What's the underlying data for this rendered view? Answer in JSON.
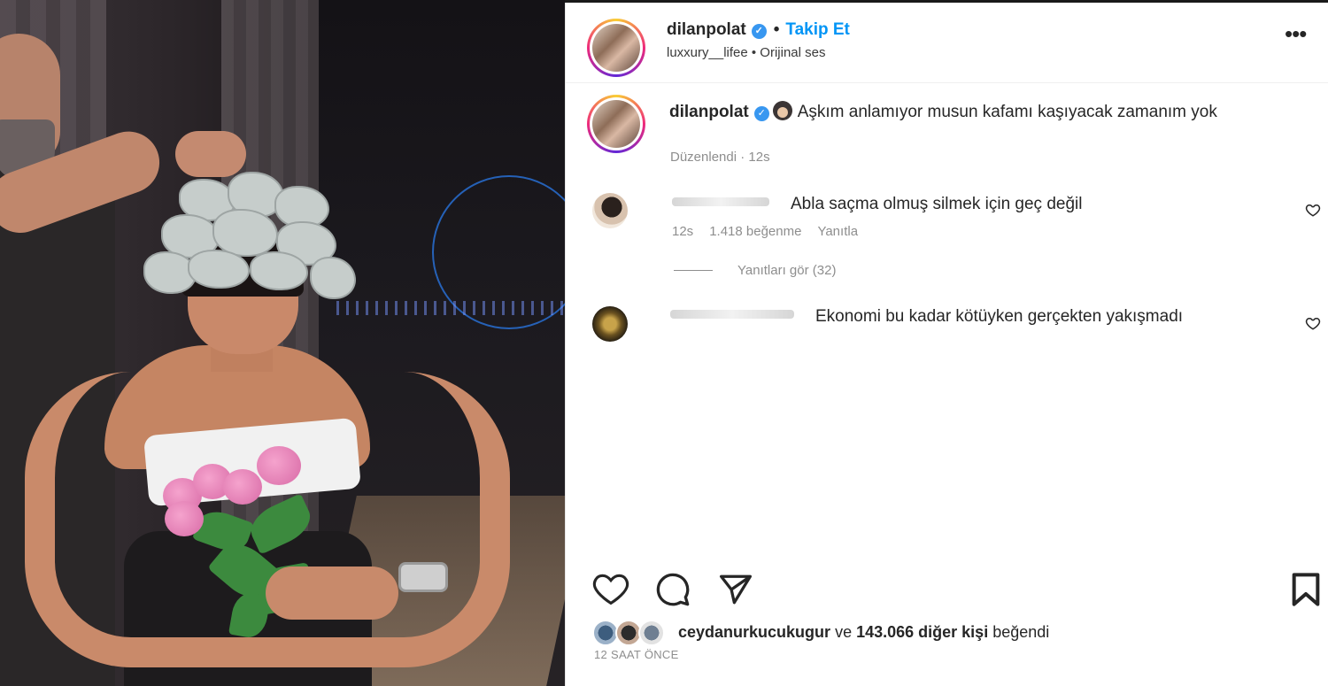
{
  "post": {
    "username": "dilanpolat",
    "follow_label": "Takip Et",
    "audio_subtitle": "luxxury__lifee • Orijinal ses",
    "more_label": "•••"
  },
  "caption": {
    "username": "dilanpolat",
    "text": "Aşkım anlamıyor musun kafamı kaşıyacak zamanım yok",
    "meta": "Düzenlendi · 12s"
  },
  "comments": [
    {
      "text": "Abla saçma olmuş silmek için geç değil",
      "time": "12s",
      "likes": "1.418 beğenme",
      "reply_label": "Yanıtla",
      "view_replies": "Yanıtları gör (32)"
    },
    {
      "text": "Ekonomi bu kadar kötüyken gerçekten yakışmadı"
    }
  ],
  "likes": {
    "liker": "ceydanurkucukugur",
    "connector": "ve",
    "others": "143.066 diğer kişi",
    "suffix": "beğendi"
  },
  "timestamp": "12 SAAT ÖNCE",
  "icons": [
    "verified-badge-icon",
    "heart-icon",
    "comment-icon",
    "share-icon",
    "bookmark-icon",
    "more-options-icon"
  ],
  "colors": {
    "accent": "#0095f6",
    "verified": "#3897f0",
    "muted": "#8e8e8e",
    "text": "#262626"
  }
}
